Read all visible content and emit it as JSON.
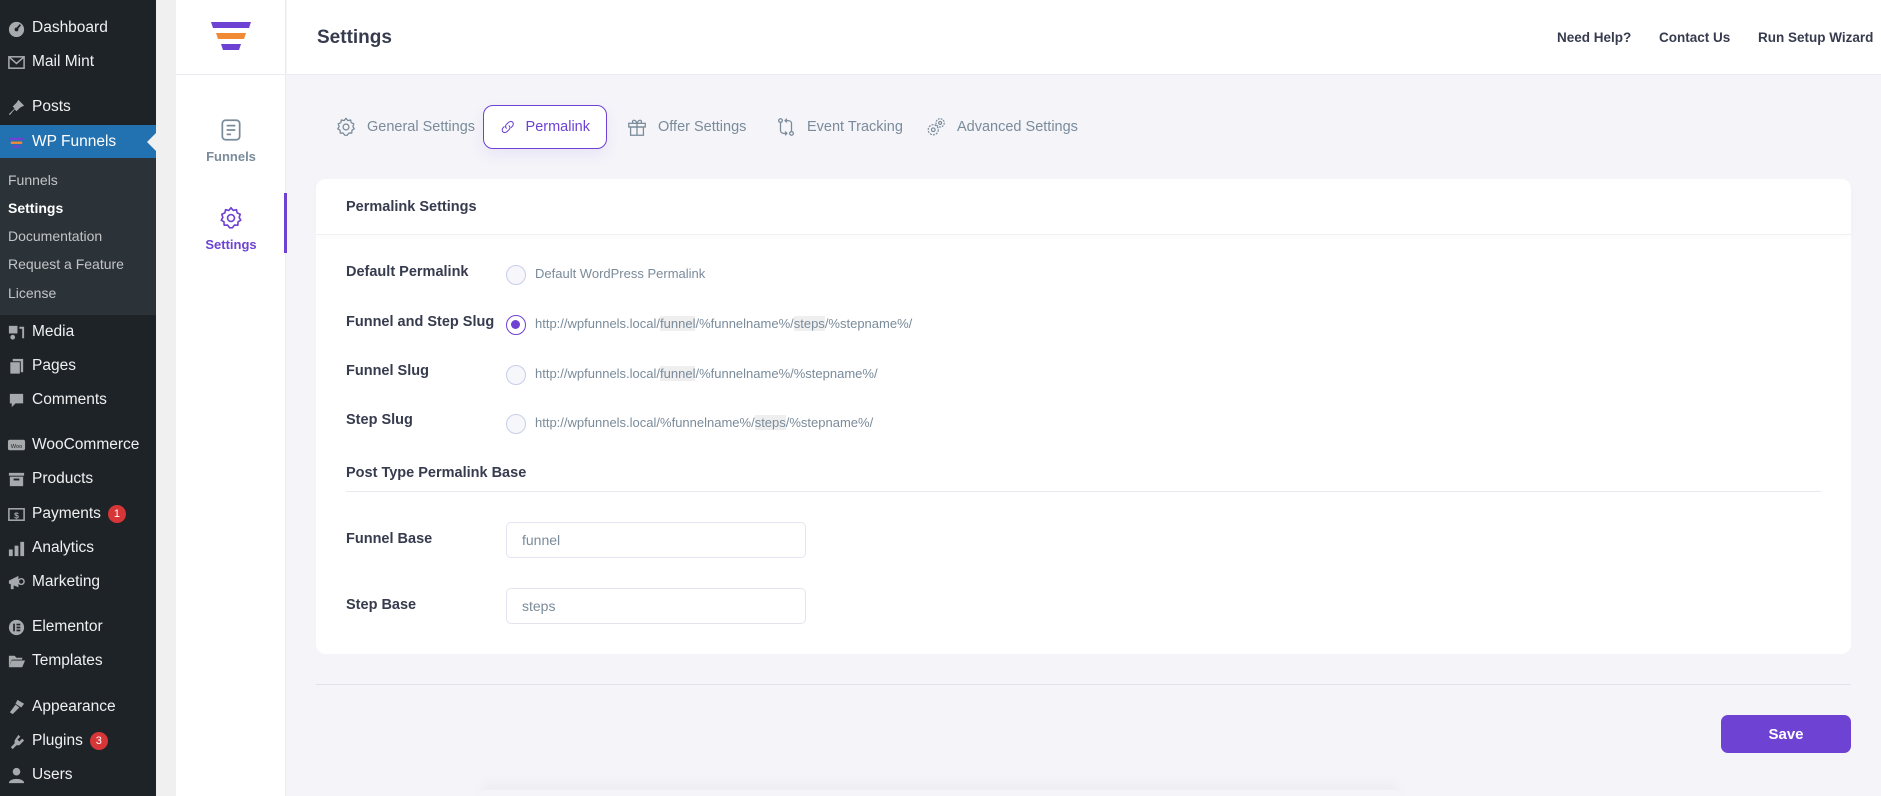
{
  "wp_menu": {
    "items": [
      {
        "label": "Dashboard",
        "icon": "dashboard-icon"
      },
      {
        "label": "Mail Mint",
        "icon": "mail-icon"
      },
      {
        "label": "Posts",
        "icon": "pin-icon"
      },
      {
        "label": "WP Funnels",
        "icon": "funnel-icon",
        "active": true
      },
      {
        "label": "Media",
        "icon": "media-icon"
      },
      {
        "label": "Pages",
        "icon": "pages-icon"
      },
      {
        "label": "Comments",
        "icon": "comment-icon"
      },
      {
        "label": "WooCommerce",
        "icon": "woo-icon"
      },
      {
        "label": "Products",
        "icon": "archive-icon"
      },
      {
        "label": "Payments",
        "icon": "dollar-icon",
        "badge": "1"
      },
      {
        "label": "Analytics",
        "icon": "bar-chart-icon"
      },
      {
        "label": "Marketing",
        "icon": "megaphone-icon"
      },
      {
        "label": "Elementor",
        "icon": "elementor-icon"
      },
      {
        "label": "Templates",
        "icon": "folder-icon"
      },
      {
        "label": "Appearance",
        "icon": "brush-icon"
      },
      {
        "label": "Plugins",
        "icon": "plug-icon",
        "badge": "3"
      },
      {
        "label": "Users",
        "icon": "user-icon"
      }
    ],
    "submenu": [
      {
        "label": "Funnels"
      },
      {
        "label": "Settings",
        "current": true
      },
      {
        "label": "Documentation"
      },
      {
        "label": "Request a Feature"
      },
      {
        "label": "License"
      }
    ]
  },
  "plugin_nav": {
    "items": [
      {
        "label": "Funnels",
        "icon": "document-icon"
      },
      {
        "label": "Settings",
        "icon": "gear-icon",
        "active": true
      }
    ]
  },
  "header": {
    "title": "Settings",
    "links": [
      "Need Help?",
      "Contact Us",
      "Run Setup Wizard"
    ]
  },
  "tabs": [
    {
      "label": "General Settings",
      "icon": "gear-icon"
    },
    {
      "label": "Permalink",
      "icon": "link-icon",
      "active": true
    },
    {
      "label": "Offer Settings",
      "icon": "gift-icon"
    },
    {
      "label": "Event Tracking",
      "icon": "git-compare-icon"
    },
    {
      "label": "Advanced Settings",
      "icon": "gears-icon"
    }
  ],
  "card": {
    "title": "Permalink Settings",
    "options": [
      {
        "label": "Default Permalink",
        "text_parts": [
          "Default WordPress Permalink"
        ],
        "checked": false
      },
      {
        "label": "Funnel and Step Slug",
        "text_parts": [
          "http://wpfunnels.local/",
          "funnel",
          "/%funnelname%/",
          "steps",
          "/%stepname%/"
        ],
        "checked": true
      },
      {
        "label": "Funnel Slug",
        "text_parts": [
          "http://wpfunnels.local/",
          "funnel",
          "/%funnelname%/%stepname%/"
        ],
        "checked": false
      },
      {
        "label": "Step Slug",
        "text_parts": [
          "http://wpfunnels.local/%funnelname%/",
          "steps",
          "/%stepname%/"
        ],
        "checked": false
      }
    ],
    "base_title": "Post Type Permalink Base",
    "funnel_base": {
      "label": "Funnel Base",
      "value": "funnel"
    },
    "step_base": {
      "label": "Step Base",
      "value": "steps"
    }
  },
  "save_label": "Save",
  "colors": {
    "accent": "#6e42d3",
    "wp_sidebar": "#1d2327",
    "wp_active": "#2271b1",
    "badge": "#d63638",
    "logo_orange": "#f08a35"
  }
}
